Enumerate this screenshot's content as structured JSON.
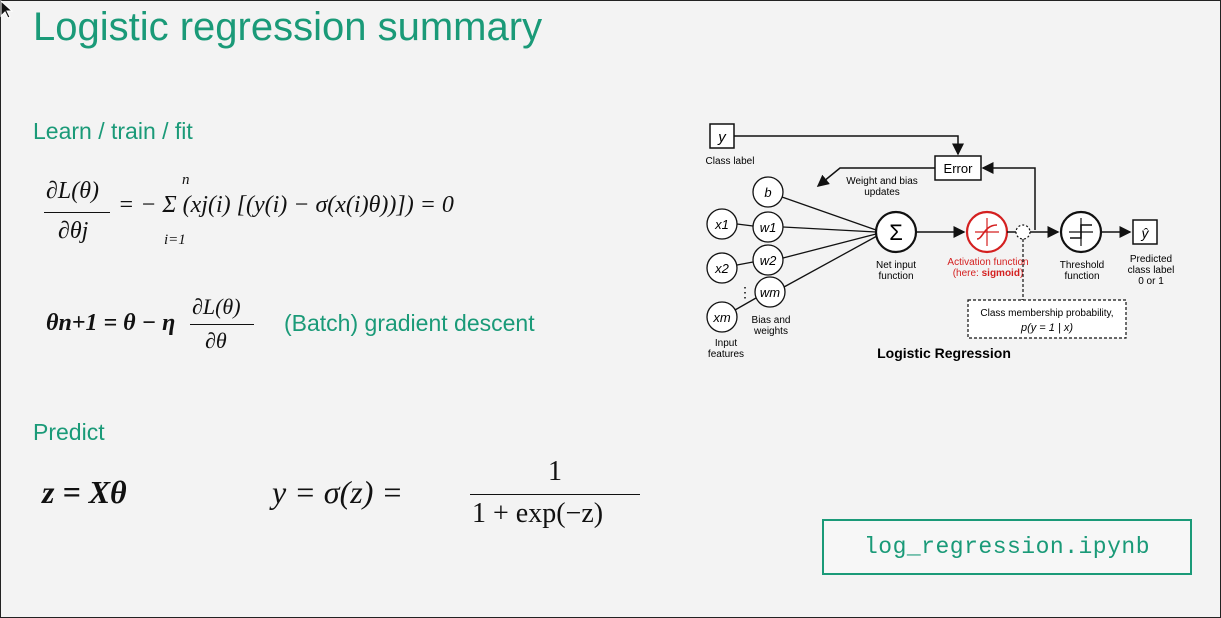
{
  "slide": {
    "title": "Logistic regression summary",
    "learn_heading": "Learn / train / fit",
    "predict_heading": "Predict",
    "gradient_caption": "(Batch) gradient descent",
    "notebook_file": "log_regression.ipynb"
  },
  "equations": {
    "gradient_lhs_num": "∂L(θ)",
    "gradient_lhs_den": "∂θj",
    "gradient_rhs": "= − Σ (xj(i) [(y(i) − σ(x(i)θ))]) = 0",
    "sum_upper": "n",
    "sum_lower": "i=1",
    "update_lhs": "θn+1 = θ − η",
    "update_num": "∂L(θ)",
    "update_den": "∂θ",
    "predict_z": "z = Xθ",
    "predict_y": "y = σ(z) =",
    "predict_num": "1",
    "predict_den": "1 + exp(−z)"
  },
  "diagram": {
    "title": "Logistic Regression",
    "class_label": "Class label",
    "y_symbol": "y",
    "error": "Error",
    "weight_bias_updates_1": "Weight and bias",
    "weight_bias_updates_2": "updates",
    "b_symbol": "b",
    "x1": "x1",
    "x2": "x2",
    "xm": "xm",
    "w1": "w1",
    "w2": "w2",
    "wm": "wm",
    "sigma_symbol": "Σ",
    "input_features_1": "Input",
    "input_features_2": "features",
    "bias_weights_1": "Bias and",
    "bias_weights_2": "weights",
    "net_input_1": "Net input",
    "net_input_2": "function",
    "activation_1": "Activation function",
    "activation_2": "(here: ",
    "activation_sigmoid": "sigmoid",
    "activation_3": ")",
    "threshold_1": "Threshold",
    "threshold_2": "function",
    "predicted_1": "Predicted",
    "predicted_2": "class label",
    "predicted_3": "0 or 1",
    "y_hat": "ŷ",
    "class_membership_1": "Class membership probability,",
    "class_membership_2": "p(y = 1 | x)"
  },
  "colors": {
    "accent": "#1a9a78",
    "activation_red": "#d42020",
    "text": "#111111"
  }
}
